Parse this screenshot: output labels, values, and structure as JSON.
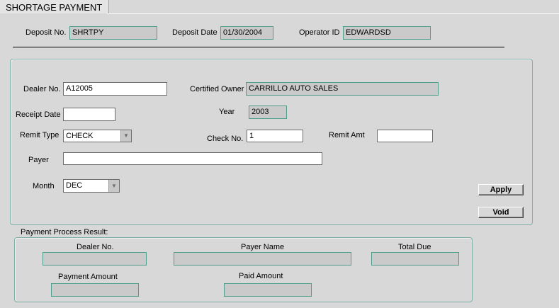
{
  "tab": {
    "title": "SHORTAGE PAYMENT"
  },
  "header": {
    "deposit_no_label": "Deposit No.",
    "deposit_no_value": "SHRTPY",
    "deposit_date_label": "Deposit Date",
    "deposit_date_value": "01/30/2004",
    "operator_id_label": "Operator ID",
    "operator_id_value": "EDWARDSD"
  },
  "form": {
    "dealer_no_label": "Dealer No.",
    "dealer_no_value": "A12005",
    "certified_owner_label": "Certified Owner",
    "certified_owner_value": "CARRILLO AUTO SALES",
    "receipt_date_label": "Receipt Date",
    "receipt_date_value": "",
    "year_label": "Year",
    "year_value": "2003",
    "remit_type_label": "Remit Type",
    "remit_type_value": "CHECK",
    "check_no_label": "Check No.",
    "check_no_value": "1",
    "remit_amt_label": "Remit Amt",
    "remit_amt_value": "",
    "payer_label": "Payer",
    "payer_value": "",
    "month_label": "Month",
    "month_value": "DEC",
    "apply_label": "Apply",
    "void_label": "Void"
  },
  "result": {
    "title": "Payment Process Result:",
    "dealer_no_label": "Dealer No.",
    "dealer_no_value": "",
    "payer_name_label": "Payer Name",
    "payer_name_value": "",
    "total_due_label": "Total Due",
    "total_due_value": "",
    "payment_amount_label": "Payment Amount",
    "payment_amount_value": "",
    "paid_amount_label": "Paid Amount",
    "paid_amount_value": ""
  }
}
